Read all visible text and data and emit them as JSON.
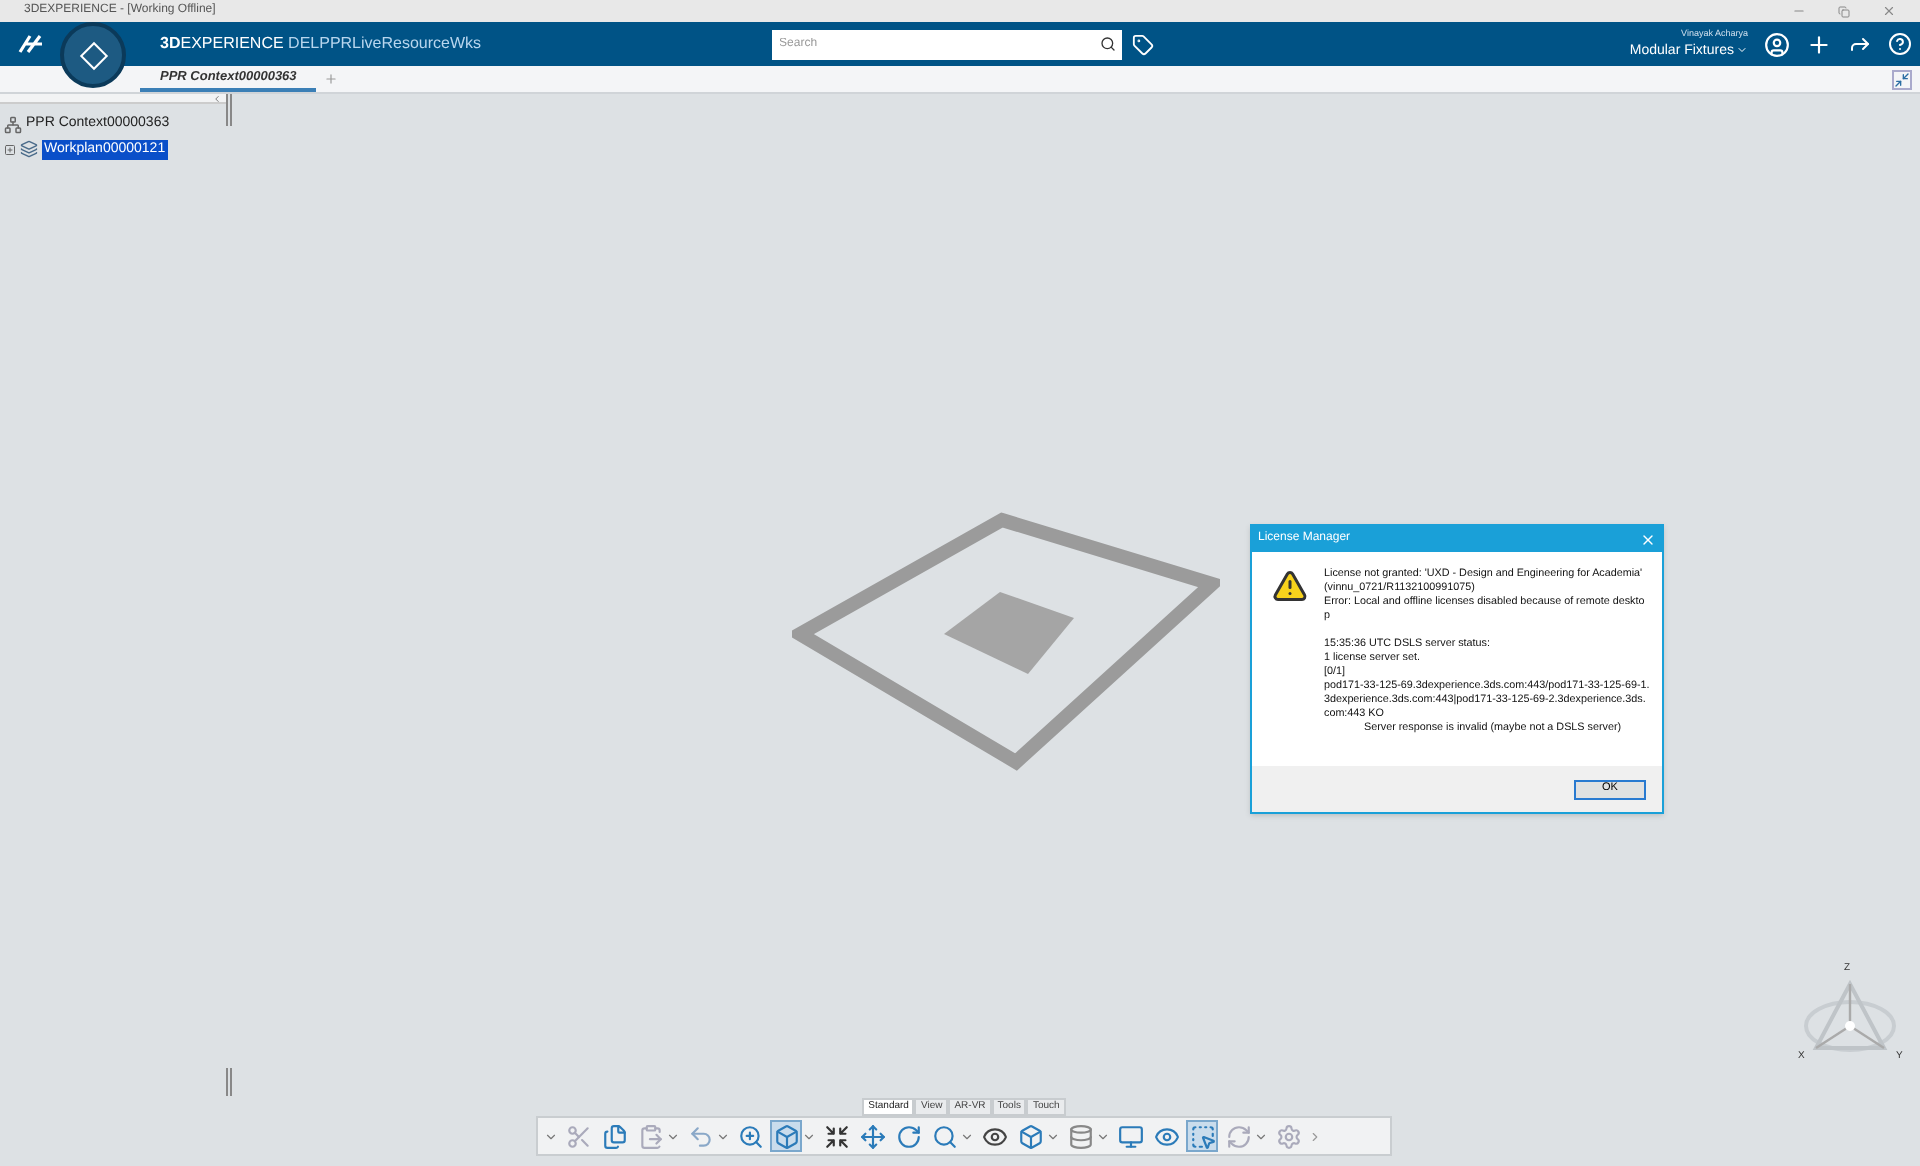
{
  "window": {
    "title": "3DEXPERIENCE - [Working Offline]"
  },
  "top_bar": {
    "brand": "**3D**EXPERIENCE",
    "app_name": "DELPPRLiveResourceWks",
    "search": {
      "placeholder": "Search"
    },
    "user": "Vinayak Acharya",
    "collaborative_space": "Modular Fixtures"
  },
  "tabs": [
    {
      "label": "PPR Context00000363",
      "selected": true
    }
  ],
  "tree": {
    "label": "PPR Context00000363",
    "children": [
      {
        "label": "Workplan00000121",
        "selected": true
      }
    ]
  },
  "dialog": {
    "title": "License Manager",
    "lines": [
      {
        "text": "License not granted: 'UXD - Design and Engineering for Academia' (vinnu_0721/R1132100991075)",
        "kind": "text"
      },
      {
        "text": "Error: Local and offline licenses disabled because of remote desktop",
        "kind": "text"
      },
      {
        "text": "15:35:36 UTC DSLS server status:",
        "kind": "gap"
      },
      {
        "text": "1 license server set.",
        "kind": "text"
      },
      {
        "text": "[0/1]",
        "kind": "text"
      },
      {
        "text": "pod171-33-125-69.3dexperience.3ds.com:443/pod171-33-125-69-1.3dexperience.3ds.com:443|pod171-33-125-69-2.3dexperience.3ds.com:443 KO",
        "kind": "text"
      },
      {
        "text": "Server response is invalid (maybe not a DSLS server)",
        "kind": "indent"
      }
    ],
    "button": "OK"
  },
  "toolbar": {
    "tabs": [
      {
        "label": "Standard",
        "selected": true
      },
      {
        "label": "View",
        "selected": false
      },
      {
        "label": "AR-VR",
        "selected": false
      },
      {
        "label": "Tools",
        "selected": false
      },
      {
        "label": "Touch",
        "selected": false
      }
    ]
  },
  "compass_axes": {
    "z": "Z",
    "x": "X",
    "y": "Y"
  }
}
